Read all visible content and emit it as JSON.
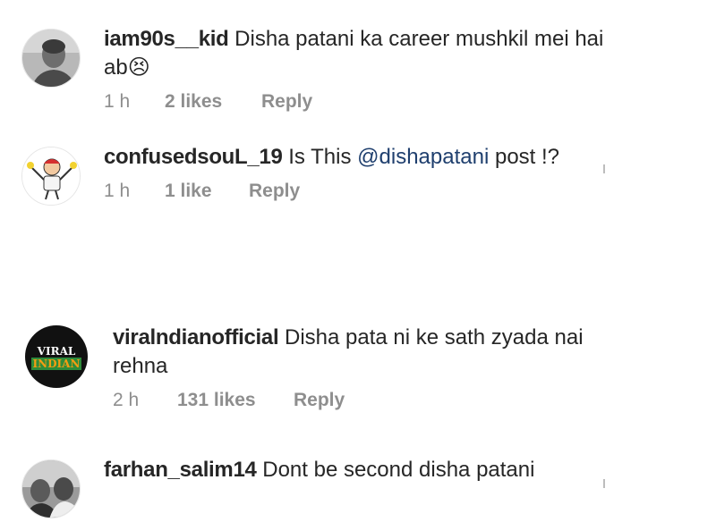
{
  "comments": [
    {
      "username": "iam90s__kid",
      "text": "Disha patani ka career mushkil mei hai ab",
      "emoji": "😣",
      "time": "1 h",
      "likes": "2 likes",
      "reply": "Reply"
    },
    {
      "username": "confusedsouL_19",
      "text_before": "Is This",
      "mention": "@dishapatani",
      "text_after": "post !?",
      "time": "1 h",
      "likes": "1 like",
      "reply": "Reply"
    },
    {
      "username": "viralndianofficial",
      "text": "Disha pata ni ke sath zyada nai rehna",
      "avatar_line1": "VIRAL",
      "avatar_line2": "INDIAN",
      "time": "2 h",
      "likes": "131 likes",
      "reply": "Reply"
    },
    {
      "username": "farhan_salim14",
      "text": "Dont be second disha patani"
    }
  ],
  "colors": {
    "text": "#262626",
    "meta": "#8e8e8e",
    "mention": "#1f3f6e",
    "avatar3_bg": "#111111",
    "avatar3_green": "#2e8b3a",
    "avatar3_orange": "#f39c12"
  }
}
